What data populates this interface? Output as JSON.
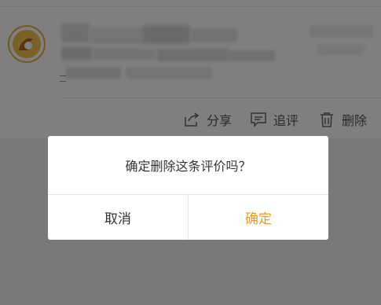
{
  "actions": {
    "share_label": "分享",
    "append_label": "追评",
    "delete_label": "删除"
  },
  "dialog": {
    "message": "确定删除这条评价吗？",
    "cancel_label": "取消",
    "confirm_label": "确定"
  },
  "colors": {
    "confirm_accent": "#f39c12",
    "avatar_ring": "#e9b243"
  },
  "icons": {
    "avatar": "user-avatar",
    "share": "share-icon",
    "append": "comment-icon",
    "delete": "trash-icon"
  }
}
